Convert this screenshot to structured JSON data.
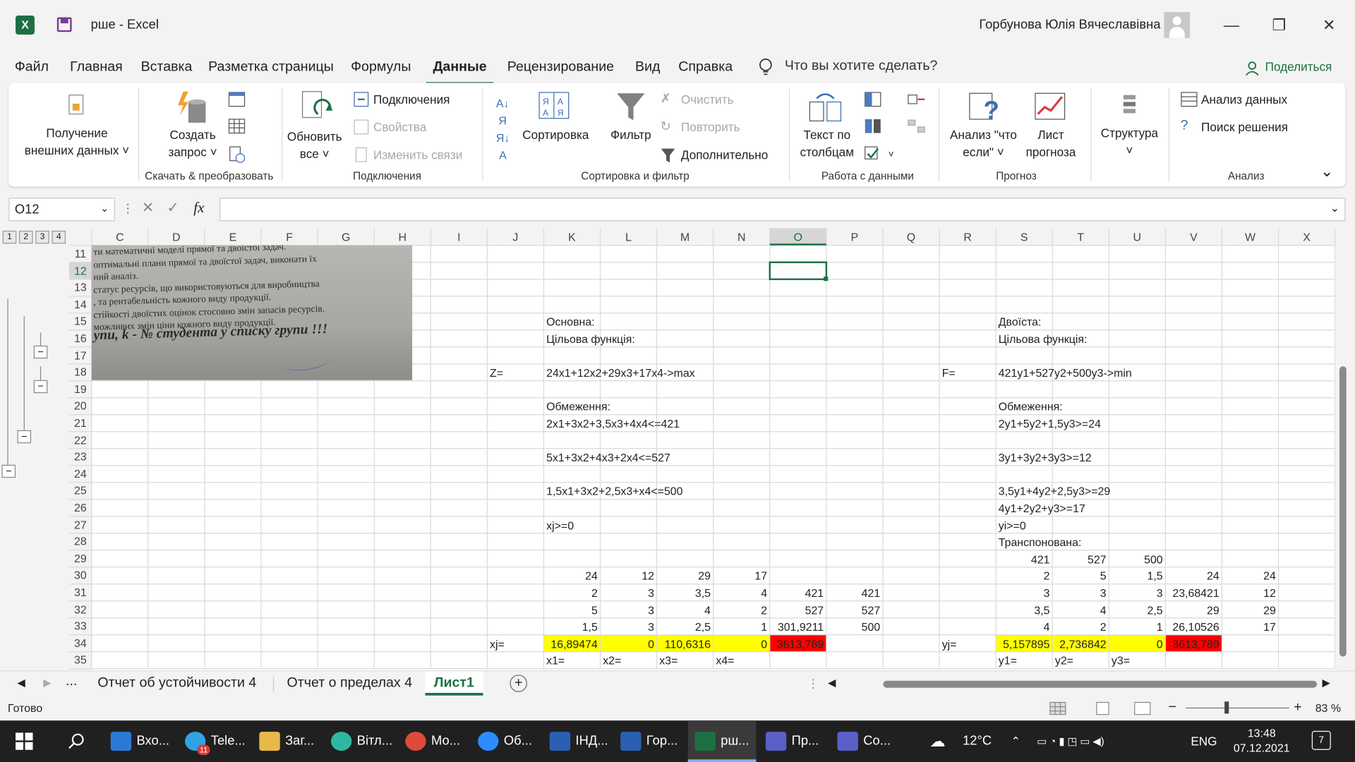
{
  "window": {
    "title": "рше  -  Excel",
    "user": "Горбунова Юлія Вячеславівна"
  },
  "menu": {
    "items": [
      "Файл",
      "Главная",
      "Вставка",
      "Разметка страницы",
      "Формулы",
      "Данные",
      "Рецензирование",
      "Вид",
      "Справка"
    ],
    "active": "Данные",
    "tell_me": "Что вы хотите сделать?",
    "share": "Поделиться"
  },
  "ribbon": {
    "get_external_1": "Получение",
    "get_external_2": "внешних данных ˅",
    "create_query_1": "Создать",
    "create_query_2": "запрос ˅",
    "group_get_transform": "Скачать & преобразовать",
    "refresh_1": "Обновить",
    "refresh_2": "все ˅",
    "connections": "Подключения",
    "properties": "Свойства",
    "edit_links": "Изменить связи",
    "group_connections": "Подключения",
    "sort": "Сортировка",
    "filter": "Фильтр",
    "clear": "Очистить",
    "reapply": "Повторить",
    "advanced": "Дополнительно",
    "group_sort_filter": "Сортировка и фильтр",
    "text_to_cols_1": "Текст по",
    "text_to_cols_2": "столбцам",
    "group_data_tools": "Работа с данными",
    "whatif_1": "Анализ \"что",
    "whatif_2": "если\" ˅",
    "forecast_1": "Лист",
    "forecast_2": "прогноза",
    "group_forecast": "Прогноз",
    "outline_1": "Структура",
    "data_analysis": "Анализ данных",
    "solver": "Поиск решения",
    "group_analysis": "Анализ"
  },
  "formula_bar": {
    "name_box": "O12",
    "fx": "fx",
    "content": ""
  },
  "grid": {
    "outline_levels": [
      "1",
      "2",
      "3",
      "4"
    ],
    "columns": [
      "C",
      "D",
      "E",
      "F",
      "G",
      "H",
      "I",
      "J",
      "K",
      "L",
      "M",
      "N",
      "O",
      "P",
      "Q",
      "R",
      "S",
      "T",
      "U",
      "V",
      "W",
      "X"
    ],
    "rows": [
      "11",
      "12",
      "13",
      "14",
      "15",
      "16",
      "17",
      "18",
      "19",
      "20",
      "21",
      "22",
      "23",
      "24",
      "25",
      "26",
      "27",
      "28",
      "29",
      "30",
      "31",
      "32",
      "33",
      "34",
      "35"
    ],
    "selected_cell": "O12",
    "image_lines": [
      "ти математичні моделі прямої та двоїстої задач.",
      "оптимальні плани прямої та двоїстої задач, виконати їх",
      "ний аналіз.",
      "статус ресурсів, що використовуються для виробництва",
      ", та рентабельність кожного виду продукції.",
      "стійкості двоїстих оцінок стосовно змін запасів ресурсів.",
      "можливих змін ціни кожного виду продукції.",
      "упи, k - № студента у списку групи !!!"
    ],
    "cells": {
      "K15": "Основна:",
      "K16": "Цільова функція:",
      "J18": "Z=",
      "K18": "24x1+12x2+29x3+17x4->max",
      "K20": "Обмеження:",
      "K21": "2x1+3x2+3,5x3+4x4<=421",
      "K23": "5x1+3x2+4x3+2x4<=527",
      "K25": "1,5x1+3x2+2,5x3+x4<=500",
      "K27": "xj>=0",
      "S15": "Двоїста:",
      "S16": "Цільова функція:",
      "R18": "F=",
      "S18": "421y1+527y2+500y3->min",
      "S20": "Обмеження:",
      "S21": "2y1+5y2+1,5y3>=24",
      "S23": "3y1+3y2+3y3>=12",
      "S25": "3,5y1+4y2+2,5y3>=29",
      "S26": "4y1+2y2+y3>=17",
      "S27": "yi>=0",
      "S28": "Транспонована:",
      "S29": "421",
      "T29": "527",
      "U29": "500",
      "K30": "24",
      "L30": "12",
      "M30": "29",
      "N30": "17",
      "S30": "2",
      "T30": "5",
      "U30": "1,5",
      "V30": "24",
      "W30": "24",
      "K31": "2",
      "L31": "3",
      "M31": "3,5",
      "N31": "4",
      "O31": "421",
      "P31": "421",
      "S31": "3",
      "T31": "3",
      "U31": "3",
      "V31": "23,68421",
      "W31": "12",
      "K32": "5",
      "L32": "3",
      "M32": "4",
      "N32": "2",
      "O32": "527",
      "P32": "527",
      "S32": "3,5",
      "T32": "4",
      "U32": "2,5",
      "V32": "29",
      "W32": "29",
      "K33": "1,5",
      "L33": "3",
      "M33": "2,5",
      "N33": "1",
      "O33": "301,9211",
      "P33": "500",
      "S33": "4",
      "T33": "2",
      "U33": "1",
      "V33": "26,10526",
      "W33": "17",
      "J34": "xj=",
      "K34": "16,89474",
      "L34": "0",
      "M34": "110,6316",
      "N34": "0",
      "O34": "3613,789",
      "R34": "yj=",
      "S34": "5,157895",
      "T34": "2,736842",
      "U34": "0",
      "V34": "3613,789",
      "K35": "x1=",
      "L35": "x2=",
      "M35": "x3=",
      "N35": "x4=",
      "S35": "y1=",
      "T35": "y2=",
      "U35": "y3="
    },
    "colors": {
      "yellow": "#ffff00",
      "red": "#ff0000",
      "accent": "#1d7044"
    }
  },
  "sheets": {
    "tabs": [
      "Отчет об устойчивости 4",
      "Отчет о пределах 4",
      "Лист1"
    ],
    "active": "Лист1",
    "more": "..."
  },
  "status": {
    "ready": "Готово",
    "zoom": "83 %"
  },
  "taskbar": {
    "apps": [
      "Вхо...",
      "Tele...",
      "Заг...",
      "Вітл...",
      "Мо...",
      "Об...",
      "ІНД...",
      "Гор...",
      "рш...",
      "Пр...",
      "Со..."
    ],
    "telegram_badge": "11",
    "weather": "12°C",
    "lang": "ENG",
    "time": "13:48",
    "date": "07.12.2021",
    "notifications": "7"
  }
}
